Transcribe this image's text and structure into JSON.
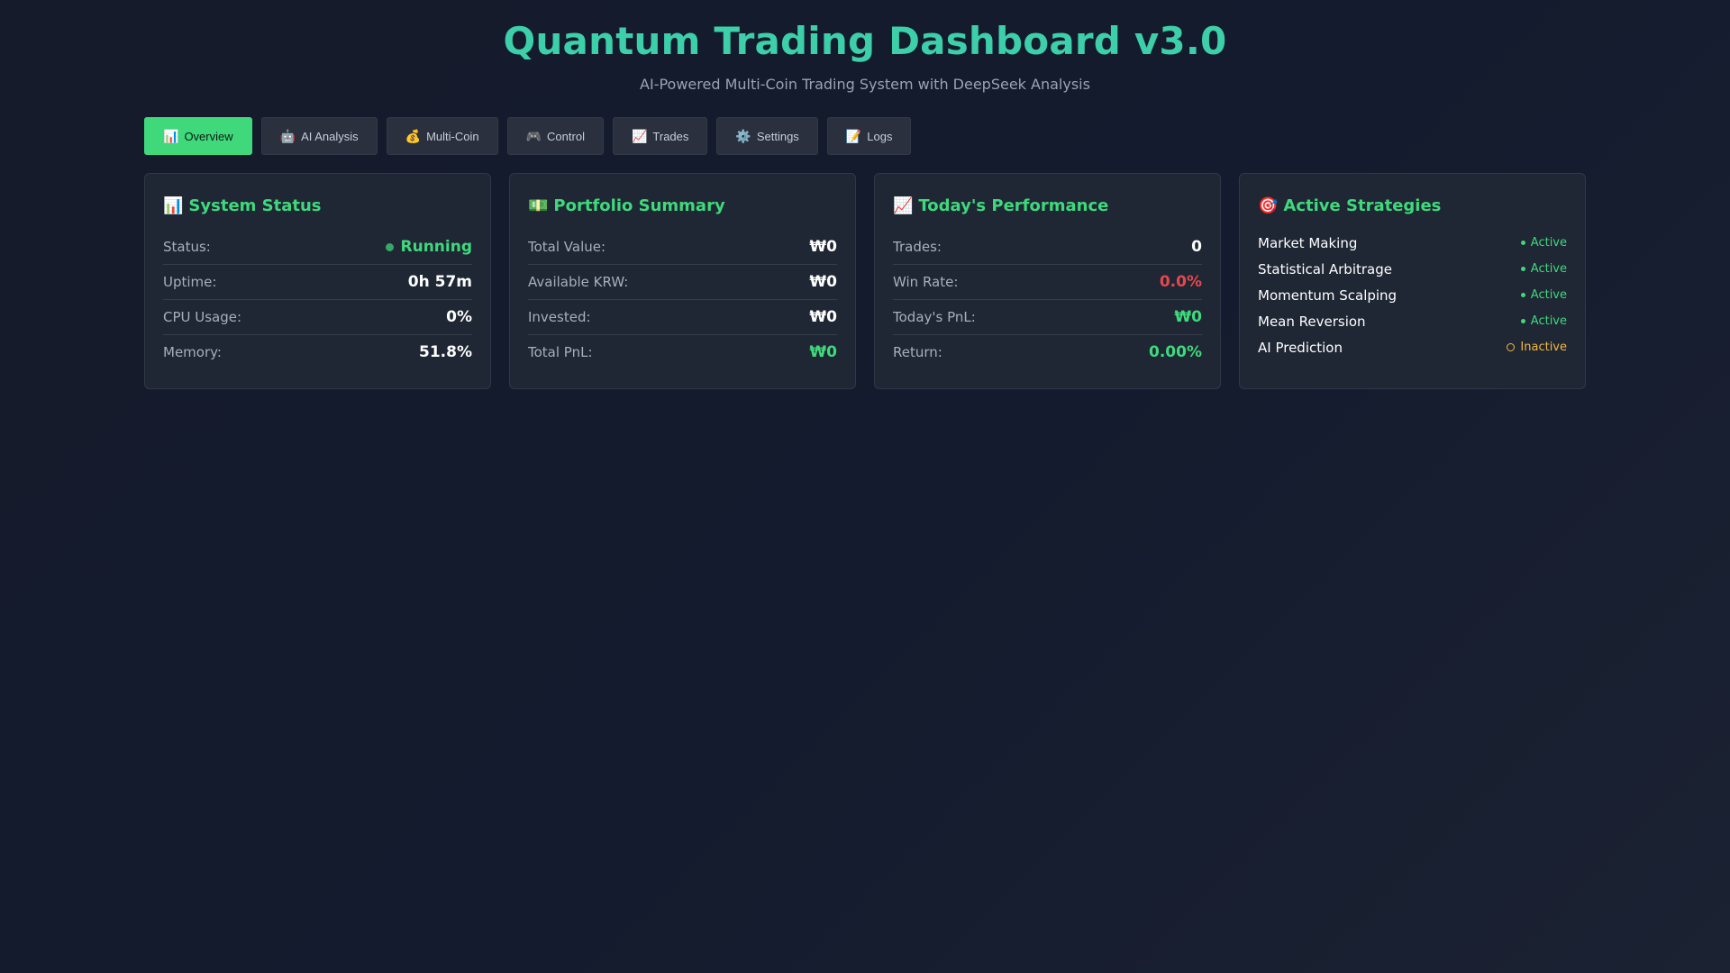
{
  "header": {
    "title": "Quantum Trading Dashboard v3.0",
    "subtitle": "AI-Powered Multi-Coin Trading System with DeepSeek Analysis"
  },
  "tabs": [
    {
      "icon": "📊",
      "icon_name": "bar-chart-icon",
      "label": "Overview",
      "active": true
    },
    {
      "icon": "🤖",
      "icon_name": "robot-icon",
      "label": "AI Analysis",
      "active": false
    },
    {
      "icon": "💰",
      "icon_name": "money-bag-icon",
      "label": "Multi-Coin",
      "active": false
    },
    {
      "icon": "🎮",
      "icon_name": "gamepad-icon",
      "label": "Control",
      "active": false
    },
    {
      "icon": "📈",
      "icon_name": "trending-up-icon",
      "label": "Trades",
      "active": false
    },
    {
      "icon": "⚙️",
      "icon_name": "gear-icon",
      "label": "Settings",
      "active": false
    },
    {
      "icon": "📝",
      "icon_name": "memo-icon",
      "label": "Logs",
      "active": false
    }
  ],
  "system_status": {
    "icon": "📊",
    "icon_name": "bar-chart-icon",
    "title": "System Status",
    "rows": [
      {
        "label": "Status:",
        "value": "Running"
      },
      {
        "label": "Uptime:",
        "value": "0h 57m"
      },
      {
        "label": "CPU Usage:",
        "value": "0%"
      },
      {
        "label": "Memory:",
        "value": "51.8%"
      }
    ]
  },
  "portfolio": {
    "icon": "💵",
    "icon_name": "banknote-icon",
    "title": "Portfolio Summary",
    "rows": [
      {
        "label": "Total Value:",
        "value": "₩0"
      },
      {
        "label": "Available KRW:",
        "value": "₩0"
      },
      {
        "label": "Invested:",
        "value": "₩0"
      },
      {
        "label": "Total PnL:",
        "value": "₩0"
      }
    ]
  },
  "performance": {
    "icon": "📈",
    "icon_name": "trending-up-icon",
    "title": "Today's Performance",
    "rows": [
      {
        "label": "Trades:",
        "value": "0"
      },
      {
        "label": "Win Rate:",
        "value": "0.0%"
      },
      {
        "label": "Today's PnL:",
        "value": "₩0"
      },
      {
        "label": "Return:",
        "value": "0.00%"
      }
    ]
  },
  "strategies": {
    "icon": "🎯",
    "icon_name": "target-icon",
    "title": "Active Strategies",
    "items": [
      {
        "name": "Market Making",
        "status": "Active"
      },
      {
        "name": "Statistical Arbitrage",
        "status": "Active"
      },
      {
        "name": "Momentum Scalping",
        "status": "Active"
      },
      {
        "name": "Mean Reversion",
        "status": "Active"
      },
      {
        "name": "AI Prediction",
        "status": "Inactive"
      }
    ]
  },
  "colors": {
    "accent": "#3fd97c",
    "title": "#3ccfa9",
    "negative": "#e5484d",
    "warning": "#f5b93d",
    "card_bg": "#1f2634"
  }
}
